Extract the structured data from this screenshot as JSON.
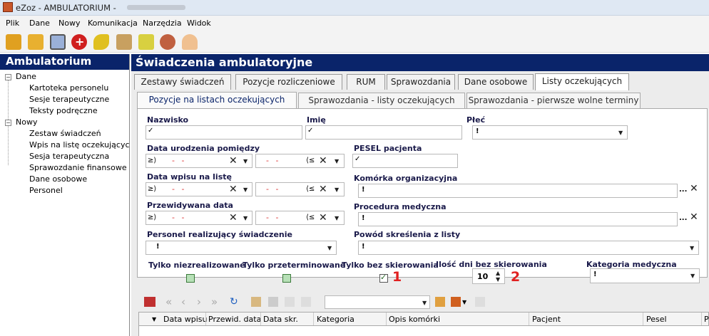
{
  "window": {
    "title": "eZoz - AMBULATORIUM -"
  },
  "menu": [
    "Plik",
    "Dane",
    "Nowy",
    "Komunikacja",
    "Narzędzia",
    "Widok"
  ],
  "toolbar_icons": [
    {
      "name": "new-record-icon",
      "color": "#e0a020"
    },
    {
      "name": "folder-icon",
      "color": "#e8b030"
    },
    {
      "name": "preview-icon",
      "color": "#6a8ac0"
    },
    {
      "name": "add-red-icon",
      "color": "#d02020"
    },
    {
      "name": "pills-icon",
      "color": "#e0c020"
    },
    {
      "name": "clipboard-icon",
      "color": "#b08040"
    },
    {
      "name": "edit-pen-icon",
      "color": "#c0b020"
    },
    {
      "name": "users-icon",
      "color": "#c06040"
    },
    {
      "name": "person-icon",
      "color": "#d0a060"
    }
  ],
  "left_panel": {
    "title": "Ambulatorium",
    "groups": [
      {
        "label": "Dane",
        "items": [
          "Kartoteka personelu",
          "Sesje terapeutyczne",
          "Teksty podręczne"
        ]
      },
      {
        "label": "Nowy",
        "items": [
          "Zestaw świadczeń",
          "Wpis na listę oczekujących",
          "Sesja terapeutyczna",
          "Sprawozdanie finansowe",
          "Dane osobowe",
          "Personel"
        ]
      }
    ]
  },
  "main": {
    "title": "Świadczenia ambulatoryjne",
    "tabs": [
      "Zestawy świadczeń",
      "Pozycje rozliczeniowe",
      "RUM",
      "Sprawozdania",
      "Dane osobowe",
      "Listy oczekujących"
    ],
    "active_tab": "Listy oczekujących",
    "subtabs": [
      "Pozycje na listach oczekujących",
      "Sprawozdania - listy oczekujących",
      "Sprawozdania - pierwsze wolne terminy"
    ],
    "active_subtab": "Pozycje na listach oczekujących"
  },
  "form": {
    "nazwisko_label": "Nazwisko",
    "imie_label": "Imię",
    "plec_label": "Płeć",
    "data_urodzenia_label": "Data urodzenia pomiędzy",
    "pesel_label": "PESEL pacjenta",
    "data_wpisu_label": "Data wpisu na listę",
    "komorka_label": "Komórka organizacyjna",
    "przewidywana_label": "Przewidywana data",
    "procedura_label": "Procedura medyczna",
    "personel_label": "Personel realizujący świadczenie",
    "powod_label": "Powód skreślenia z listy",
    "tylko_niezrealizowane": "Tylko niezrealizowane",
    "tylko_przeterminowane": "Tylko przeterminowane",
    "tylko_bez_skierowania": "Tylko bez skierowania",
    "ilosc_dni_label": "Ilość dni bez skierowania",
    "ilosc_dni_value": "10",
    "kategoria_label": "Kategoria medyczna",
    "date_placeholder": "- -",
    "op_ge": "≥⟩",
    "op_le": "⟨≤",
    "bang": "!",
    "check_glyph": "✓",
    "x_glyph": "✕",
    "dots": "...",
    "tylko_niezrealizowane_checked": false,
    "tylko_przeterminowane_checked": false,
    "tylko_bez_skierowania_checked": true
  },
  "annotations": {
    "n1": "1",
    "n2": "2",
    "color": "#e02020"
  },
  "grid": {
    "columns": [
      "Data wpisu",
      "Przewid. data",
      "Data skr.",
      "Kategoria",
      "Opis komórki",
      "Pacjent",
      "Pesel",
      "P"
    ]
  }
}
